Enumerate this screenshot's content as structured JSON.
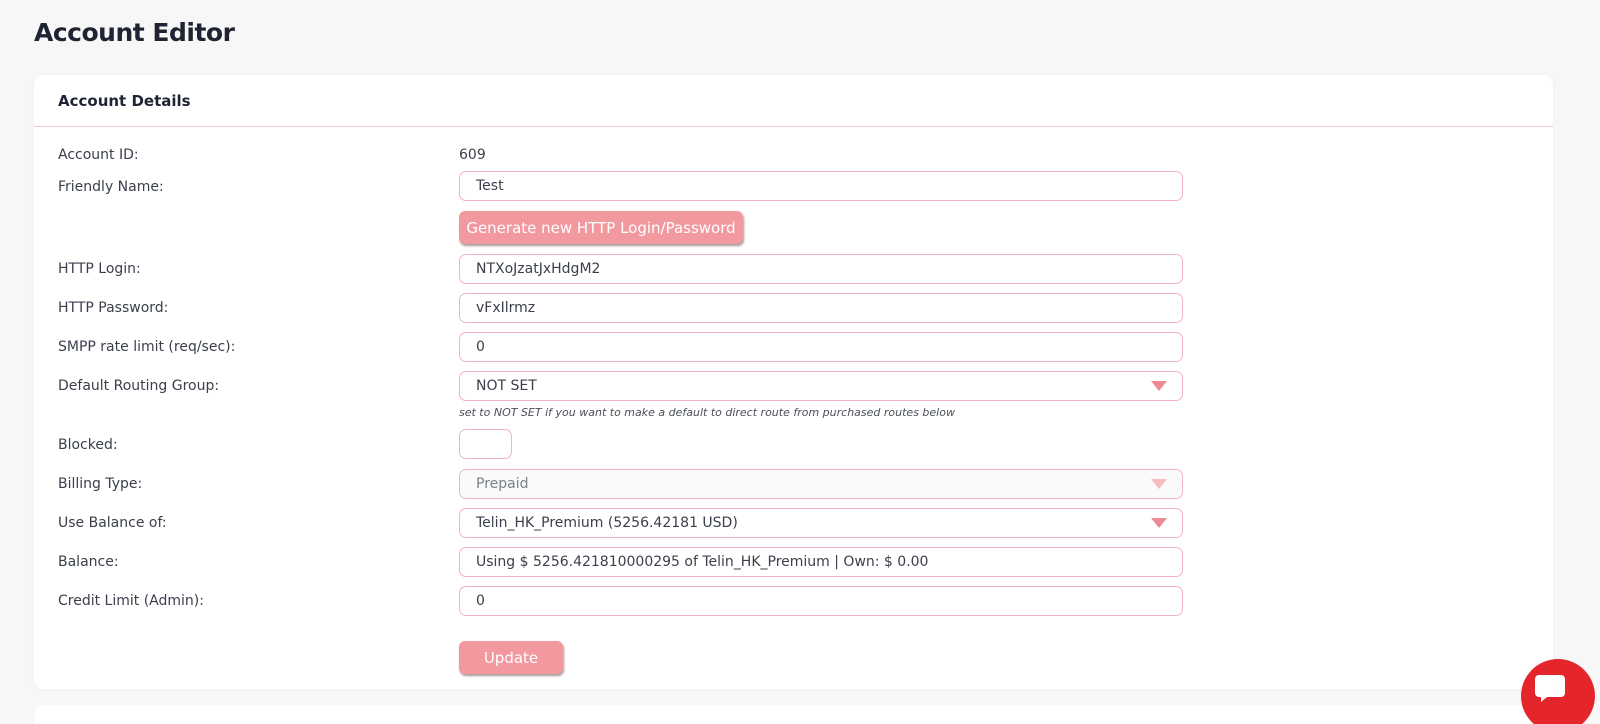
{
  "page": {
    "title": "Account Editor"
  },
  "card": {
    "title": "Account Details"
  },
  "form": {
    "account_id": {
      "label": "Account ID:",
      "value": "609"
    },
    "friendly_name": {
      "label": "Friendly Name:",
      "value": "Test"
    },
    "generate_button": {
      "label": "Generate new HTTP Login/Password"
    },
    "http_login": {
      "label": "HTTP Login:",
      "value": "NTXoJzatJxHdgM2"
    },
    "http_password": {
      "label": "HTTP Password:",
      "value": "vFxIlrmz"
    },
    "smpp_rate_limit": {
      "label": "SMPP rate limit (req/sec):",
      "value": "0"
    },
    "default_routing_group": {
      "label": "Default Routing Group:",
      "value": "NOT SET",
      "hint": "set to NOT SET if you want to make a default to direct route from purchased routes below"
    },
    "blocked": {
      "label": "Blocked:",
      "checked": false
    },
    "billing_type": {
      "label": "Billing Type:",
      "value": "Prepaid",
      "disabled": true
    },
    "use_balance_of": {
      "label": "Use Balance of:",
      "value": "Telin_HK_Premium (5256.42181 USD)"
    },
    "balance": {
      "label": "Balance:",
      "value": "Using $ 5256.421810000295 of Telin_HK_Premium | Own: $ 0.00"
    },
    "credit_limit": {
      "label": "Credit Limit (Admin):",
      "value": "0"
    },
    "update_button": {
      "label": "Update"
    }
  },
  "colors": {
    "accent": "#f2989f",
    "field_border": "#f2b4bc",
    "chat_bubble": "#e5252c"
  },
  "icons": {
    "chat": "chat-bubble-icon",
    "dropdown": "caret-down-icon"
  }
}
